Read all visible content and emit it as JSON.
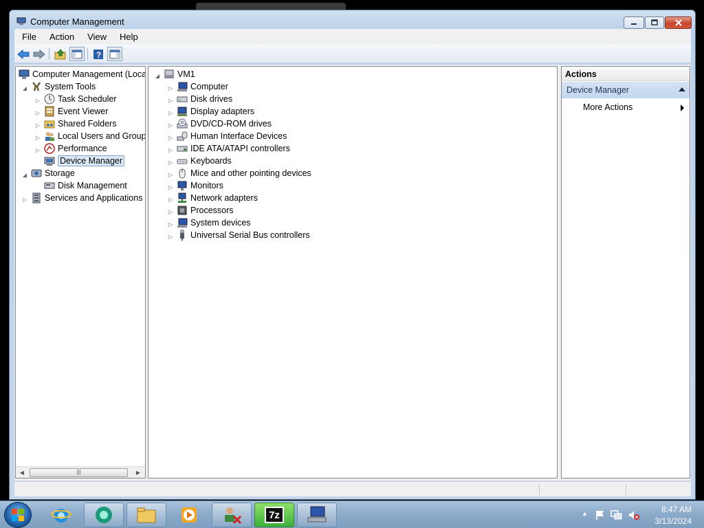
{
  "window": {
    "title": "Computer Management",
    "caption_buttons": [
      "minimize",
      "maximize",
      "close"
    ]
  },
  "menu": [
    "File",
    "Action",
    "View",
    "Help"
  ],
  "toolbar": {
    "icons": [
      "back-arrow-icon",
      "forward-arrow-icon",
      "up-folder-icon",
      "show-hide-tree-icon",
      "help-icon",
      "properties-icon"
    ]
  },
  "left_tree": {
    "items": [
      {
        "label": "Computer Management (Local",
        "icon": "computer-management-icon",
        "level": 0,
        "expander": "none"
      },
      {
        "label": "System Tools",
        "icon": "system-tools-icon",
        "level": 1,
        "expander": "expanded"
      },
      {
        "label": "Task Scheduler",
        "icon": "clock-icon",
        "level": 2,
        "expander": "collapsed"
      },
      {
        "label": "Event Viewer",
        "icon": "event-viewer-icon",
        "level": 2,
        "expander": "collapsed"
      },
      {
        "label": "Shared Folders",
        "icon": "shared-folders-icon",
        "level": 2,
        "expander": "collapsed"
      },
      {
        "label": "Local Users and Groups",
        "icon": "users-icon",
        "level": 2,
        "expander": "collapsed"
      },
      {
        "label": "Performance",
        "icon": "performance-icon",
        "level": 2,
        "expander": "collapsed"
      },
      {
        "label": "Device Manager",
        "icon": "device-manager-icon",
        "level": 2,
        "expander": "none",
        "selected": true
      },
      {
        "label": "Storage",
        "icon": "storage-icon",
        "level": 1,
        "expander": "expanded"
      },
      {
        "label": "Disk Management",
        "icon": "disk-management-icon",
        "level": 2,
        "expander": "none"
      },
      {
        "label": "Services and Applications",
        "icon": "services-icon",
        "level": 1,
        "expander": "collapsed"
      }
    ]
  },
  "device_tree": {
    "root": "VM1",
    "items": [
      {
        "label": "Computer",
        "icon": "computer-icon"
      },
      {
        "label": "Disk drives",
        "icon": "disk-drive-icon"
      },
      {
        "label": "Display adapters",
        "icon": "display-adapter-icon"
      },
      {
        "label": "DVD/CD-ROM drives",
        "icon": "dvd-drive-icon"
      },
      {
        "label": "Human Interface Devices",
        "icon": "hid-icon"
      },
      {
        "label": "IDE ATA/ATAPI controllers",
        "icon": "ide-controller-icon"
      },
      {
        "label": "Keyboards",
        "icon": "keyboard-icon"
      },
      {
        "label": "Mice and other pointing devices",
        "icon": "mouse-icon"
      },
      {
        "label": "Monitors",
        "icon": "monitor-icon"
      },
      {
        "label": "Network adapters",
        "icon": "network-adapter-icon"
      },
      {
        "label": "Processors",
        "icon": "processor-icon"
      },
      {
        "label": "System devices",
        "icon": "system-devices-icon"
      },
      {
        "label": "Universal Serial Bus controllers",
        "icon": "usb-icon"
      }
    ]
  },
  "actions": {
    "header": "Actions",
    "section": "Device Manager",
    "more": "More Actions"
  },
  "taskbar": {
    "apps": [
      "internet-explorer-icon",
      "media-center-icon",
      "file-explorer-icon",
      "media-player-icon",
      "remote-desktop-icon",
      "7zip-icon",
      "computer-management-icon"
    ],
    "active_label": "7z",
    "clock": {
      "time": "8:47 AM",
      "date": "3/13/2024"
    },
    "tray": [
      "show-hidden-icons-icon",
      "action-center-flag-icon",
      "network-icon",
      "volume-muted-icon"
    ]
  },
  "colors": {
    "selection": "#dceaf8",
    "actions_section": "#c9daf0",
    "taskbar": "#8daccb"
  }
}
